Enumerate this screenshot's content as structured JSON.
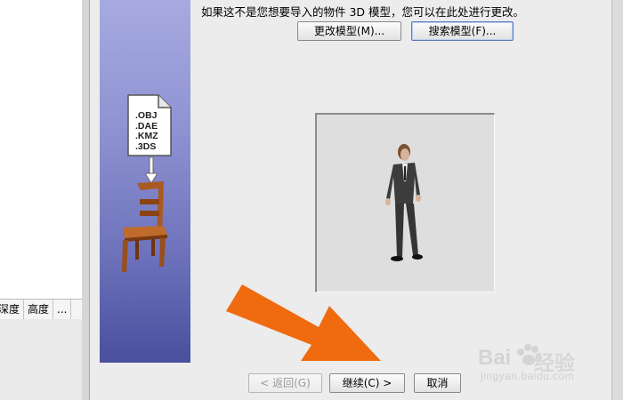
{
  "background_app": {
    "tabs": [
      "深度",
      "高度",
      "..."
    ]
  },
  "dialog": {
    "prompt": "如果这不是您想要导入的物件 3D 模型，您可以在此处进行更改。",
    "buttons": {
      "change_model": "更改模型(M)...",
      "search_model": "搜索模型(F)...",
      "back": "< 返回(G)",
      "continue": "继续(C) >",
      "cancel": "取消"
    },
    "side_panel": {
      "file_formats": [
        ".OBJ",
        ".DAE",
        ".KMZ",
        ".3DS"
      ]
    }
  },
  "watermark": {
    "brand": "经验",
    "url": "jingyan.baidu.com"
  },
  "colors": {
    "side_panel_top": "#a7aae0",
    "side_panel_bottom": "#4a4f9e",
    "arrow": "#f06a10"
  }
}
